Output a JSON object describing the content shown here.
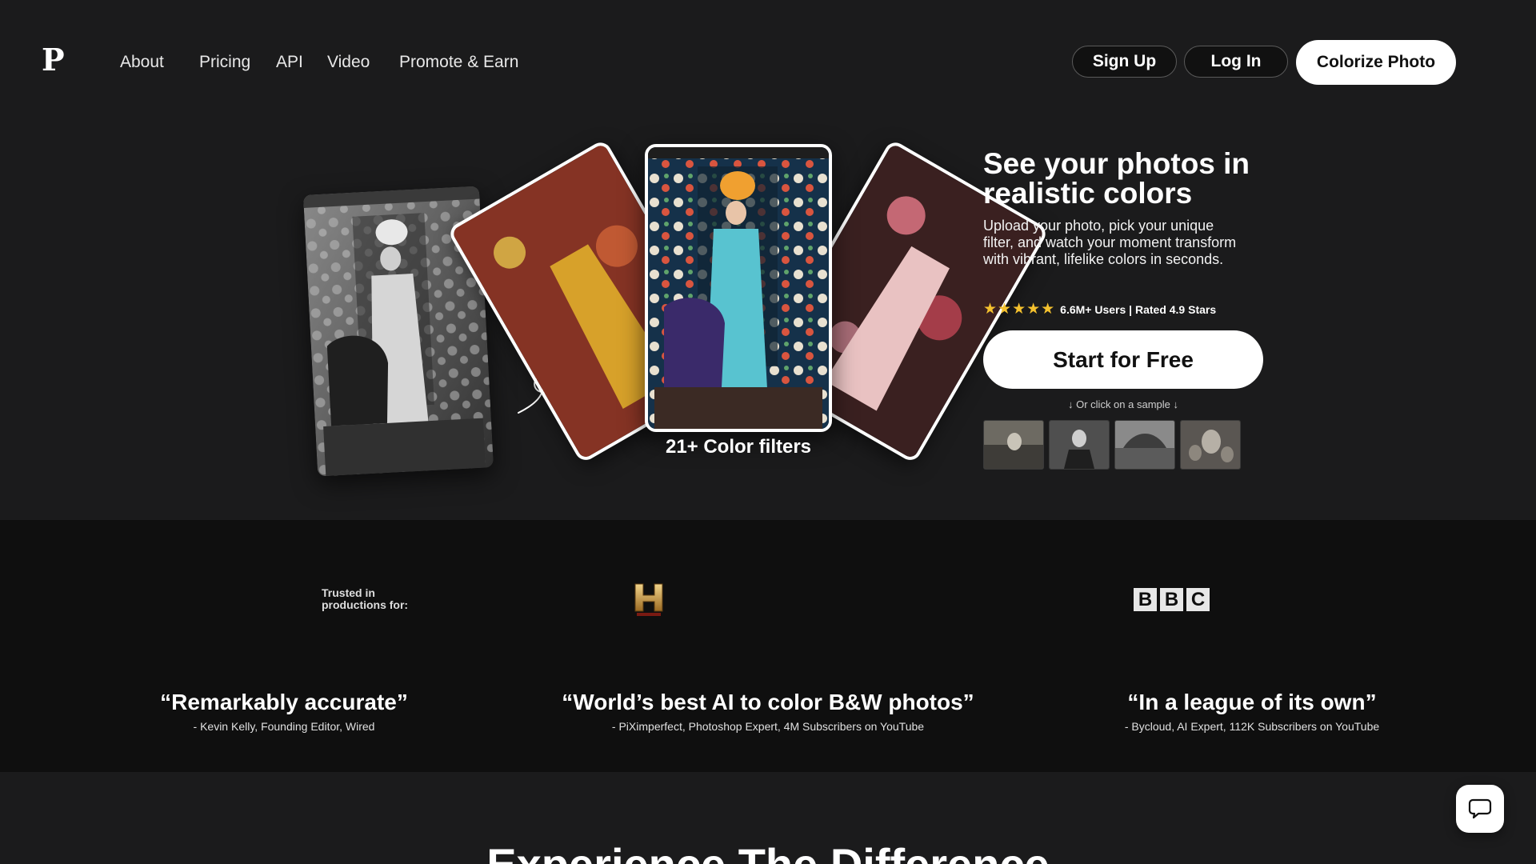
{
  "header": {
    "logo": "P",
    "nav": [
      "About",
      "Pricing",
      "API",
      "Video",
      "Promote & Earn"
    ],
    "signup_label": "Sign Up",
    "login_label": "Log In",
    "cta_label": "Colorize Photo"
  },
  "hero": {
    "title": "See your photos in realistic colors",
    "subtitle": "Upload your photo, pick your unique filter, and watch your moment transform with vibrant, lifelike colors in seconds.",
    "stars": "★★★★★",
    "rating_text": "6.6M+ Users | Rated 4.9 Stars",
    "start_label": "Start for Free",
    "sample_hint": "↓ Or click on a sample ↓",
    "filters_caption": "21+ Color filters",
    "samples_count_shown": 4
  },
  "trusted": {
    "label": "Trusted in productions for:",
    "logos": [
      "History",
      "BBC"
    ],
    "bbc_letters": [
      "B",
      "B",
      "C"
    ]
  },
  "quotes": [
    {
      "text": "“Remarkably accurate”",
      "author": "- Kevin Kelly, Founding Editor, Wired"
    },
    {
      "text": "“World’s best AI to color B&W photos”",
      "author": "- PiXimperfect, Photoshop Expert, 4M Subscribers on YouTube"
    },
    {
      "text": "“In a league of its own”",
      "author": "- Bycloud, AI Expert, 112K Subscribers on YouTube"
    }
  ],
  "bottom": {
    "heading": "Experience The Difference"
  },
  "colors": {
    "background": "#1b1b1c",
    "band": "#0f0f0f",
    "star": "#f4c12e",
    "button": "#ffffff"
  },
  "icons": [
    "logo-p-icon",
    "arrow-swirl-icon",
    "star-icon",
    "history-logo-icon",
    "chat-bubble-icon"
  ]
}
